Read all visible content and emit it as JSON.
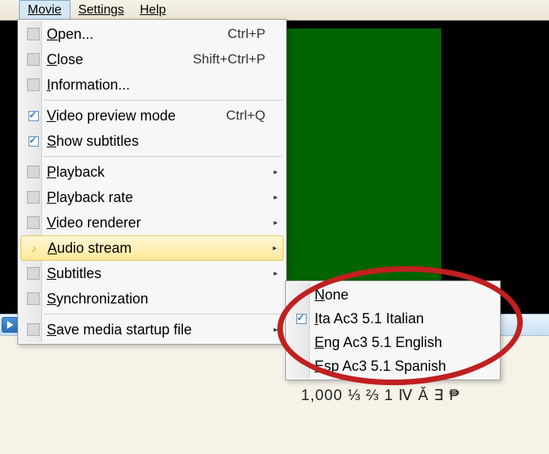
{
  "menubar": {
    "items": [
      {
        "label": "Movie",
        "active": true
      },
      {
        "label": "Settings",
        "active": false
      },
      {
        "label": "Help",
        "active": false
      }
    ]
  },
  "main_menu": {
    "items": [
      {
        "label": "Open...",
        "accel": "O",
        "shortcut": "Ctrl+P",
        "type": "item"
      },
      {
        "label": "Close",
        "accel": "C",
        "shortcut": "Shift+Ctrl+P",
        "type": "item"
      },
      {
        "label": "Information...",
        "accel": "I",
        "shortcut": "",
        "type": "item"
      },
      {
        "type": "sep"
      },
      {
        "label": "Video preview mode",
        "accel": "V",
        "shortcut": "Ctrl+Q",
        "type": "check",
        "checked": true
      },
      {
        "label": "Show subtitles",
        "accel": "S",
        "shortcut": "",
        "type": "check",
        "checked": true
      },
      {
        "type": "sep"
      },
      {
        "label": "Playback",
        "accel": "P",
        "type": "submenu"
      },
      {
        "label": "Playback rate",
        "accel": "P",
        "type": "submenu"
      },
      {
        "label": "Video renderer",
        "accel": "V",
        "type": "submenu"
      },
      {
        "label": "Audio stream",
        "accel": "A",
        "type": "submenu",
        "highlighted": true,
        "icon": "music"
      },
      {
        "label": "Subtitles",
        "accel": "S",
        "type": "submenu"
      },
      {
        "label": "Synchronization",
        "accel": "S",
        "type": "item"
      },
      {
        "type": "sep"
      },
      {
        "label": "Save media startup file",
        "accel": "S",
        "type": "submenu"
      }
    ]
  },
  "submenu_audio": {
    "items": [
      {
        "label": "None",
        "accel": "N",
        "checked": false
      },
      {
        "label": "Ita Ac3 5.1 Italian",
        "accel": "I",
        "checked": true
      },
      {
        "label": "Eng Ac3 5.1 English",
        "accel": "E",
        "checked": false
      },
      {
        "label": "Esp Ac3 5.1 Spanish",
        "accel": "E",
        "checked": false
      }
    ]
  },
  "status_line": "1,000  ⅓ ⅔ 1 Ⅳ Ǎ ∃ ₱"
}
